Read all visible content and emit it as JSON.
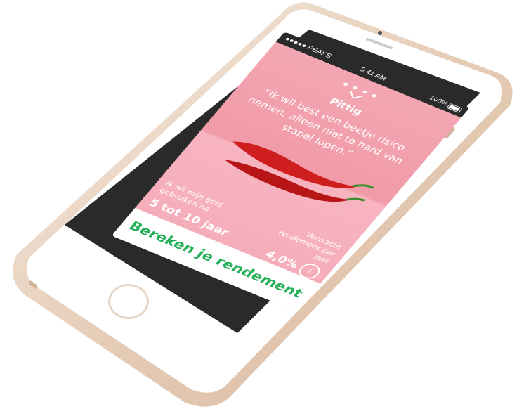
{
  "status": {
    "carrier": "●●●●● PEAKS",
    "time": "9:41 AM",
    "battery": "100%"
  },
  "carousel": {
    "dots": 4
  },
  "card": {
    "title": "Pittig",
    "quote": "“Ik wil best een beetje risico nemen, alleen niet te hard van stapel lopen.”"
  },
  "stats": {
    "horizon_label": "Ik wil mijn geld gebruiken na",
    "horizon_value": "5 tot 10 jaar",
    "return_label": "Verwacht rendement per jaar",
    "return_value": "4,0%"
  },
  "cta": {
    "label": "Bereken je rendement"
  },
  "colors": {
    "accent": "#25b05a",
    "background": "#f3a7b2",
    "chili": "#cf1e1e"
  },
  "icons": {
    "chevron": "chevron-down-icon",
    "info": "info-icon"
  }
}
